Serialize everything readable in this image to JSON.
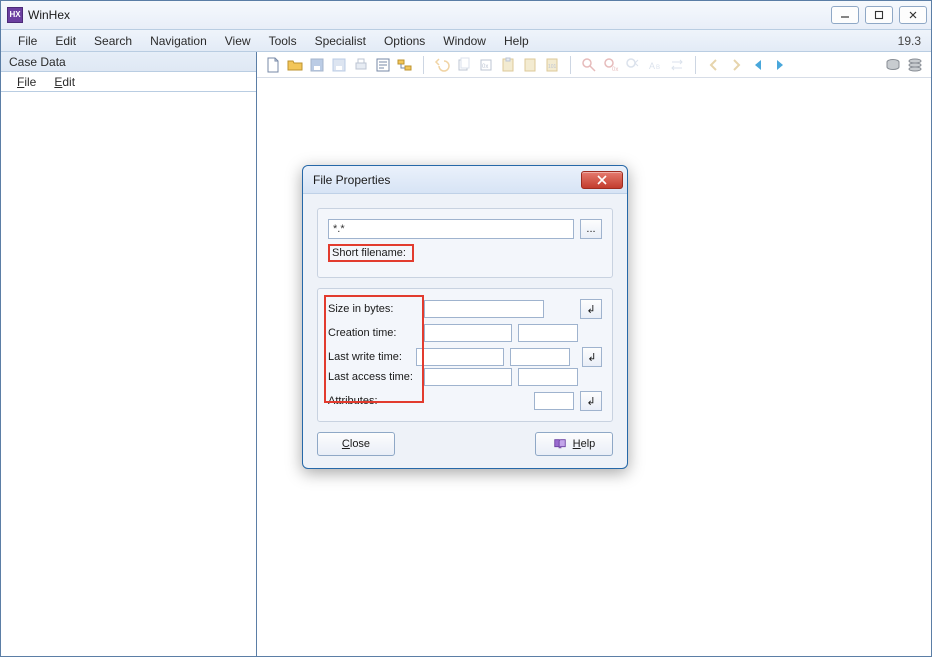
{
  "window": {
    "title": "WinHex",
    "version": "19.3"
  },
  "menubar": {
    "items": [
      "File",
      "Edit",
      "Search",
      "Navigation",
      "View",
      "Tools",
      "Specialist",
      "Options",
      "Window",
      "Help"
    ]
  },
  "left_pane": {
    "header": "Case Data",
    "menu": {
      "file_label": "File",
      "edit_html": "Edit"
    }
  },
  "toolbar": {
    "icons": [
      "new-file-icon",
      "open-icon",
      "save-icon",
      "save-copy-icon",
      "print-icon",
      "properties-icon",
      "folder-tree-icon",
      "sep",
      "undo-icon",
      "copy-icon",
      "copy-hex-icon",
      "paste-icon",
      "clipboard-special1-icon",
      "clipboard-special2-icon",
      "sep",
      "find-icon",
      "find-hex-icon",
      "find-again-icon",
      "find-text-icon",
      "replace-icon",
      "sep",
      "nav-back-icon",
      "nav-forward-icon",
      "go-left-icon",
      "go-right-icon",
      "sep",
      "disk-icon",
      "disks-icon"
    ]
  },
  "dialog": {
    "title": "File Properties",
    "filename_value": "*.*",
    "browse_label": "...",
    "labels": {
      "short_filename": "Short filename:",
      "size_in_bytes": "Size in bytes:",
      "creation_time": "Creation time:",
      "last_write_time": "Last write time:",
      "last_access_time": "Last access time:",
      "attributes": "Attributes:"
    },
    "values": {
      "short_filename": "",
      "size_in_bytes": "",
      "creation_date": "",
      "creation_time": "",
      "last_write_date": "",
      "last_write_time": "",
      "last_access_date": "",
      "last_access_time": "",
      "attributes": ""
    },
    "apply1_label": "↲",
    "apply2_label": "↲",
    "apply3_label": "↲",
    "close_label": "Close",
    "help_label": "Help"
  }
}
